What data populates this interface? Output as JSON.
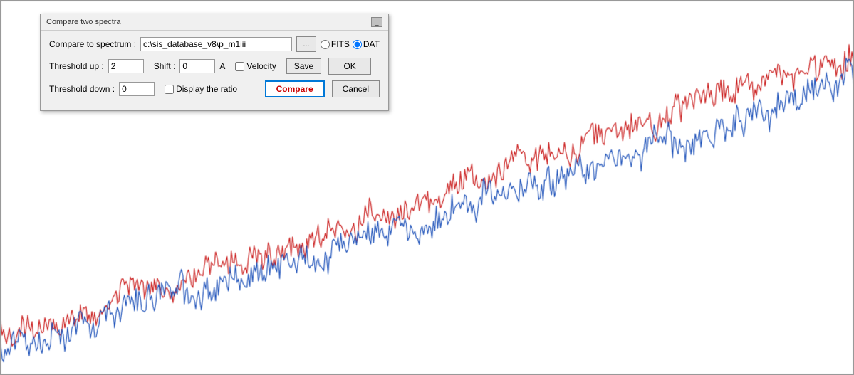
{
  "dialog": {
    "title": "Compare two spectra",
    "spectrum_label": "Compare to spectrum :",
    "spectrum_value": "c:\\sis_database_v8\\p_m1iii",
    "browse_label": "...",
    "fits_label": "FITS",
    "dat_label": "DAT",
    "threshold_up_label": "Threshold up :",
    "threshold_up_value": "2",
    "shift_label": "Shift :",
    "shift_value": "0",
    "angstrom_label": "A",
    "velocity_label": "Velocity",
    "save_label": "Save",
    "ok_label": "OK",
    "threshold_down_label": "Threshold down :",
    "threshold_down_value": "0",
    "display_ratio_label": "Display the ratio",
    "compare_label": "Compare",
    "cancel_label": "Cancel"
  },
  "chart": {
    "bg_color": "#ffffff",
    "red_color": "#cc2222",
    "blue_color": "#2255bb"
  }
}
